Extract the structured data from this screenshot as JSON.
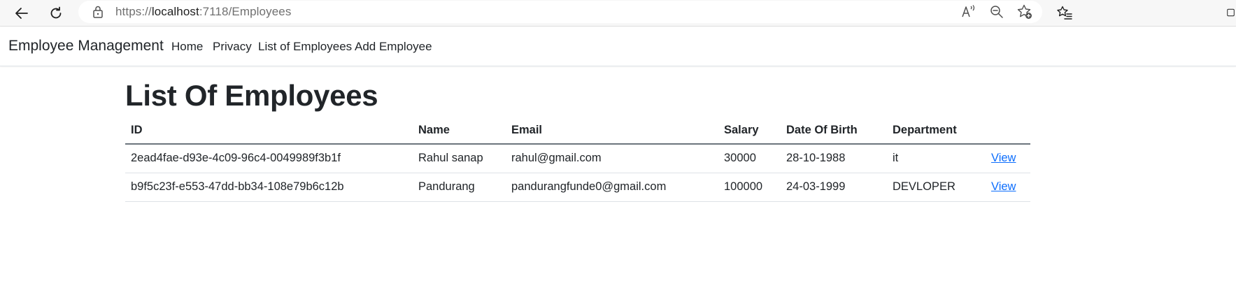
{
  "browser": {
    "url_scheme": "https://",
    "url_host": "localhost",
    "url_path": ":7118/Employees"
  },
  "icons": {
    "back": "back-arrow-icon",
    "reload": "reload-icon",
    "lock": "lock-icon",
    "read_aloud": "read-aloud-icon",
    "zoom_out": "zoom-out-icon",
    "add_favorite": "add-favorite-icon",
    "favorites": "favorites-icon"
  },
  "navbar": {
    "brand": "Employee Management",
    "links": [
      "Home",
      "Privacy",
      "List of Employees",
      "Add Employee"
    ]
  },
  "page": {
    "title": "List Of Employees"
  },
  "table": {
    "headers": [
      "ID",
      "Name",
      "Email",
      "Salary",
      "Date Of Birth",
      "Department"
    ],
    "rows": [
      [
        "2ead4fae-d93e-4c09-96c4-0049989f3b1f",
        "Rahul sanap",
        "rahul@gmail.com",
        "30000",
        "28-10-1988",
        "it",
        "View"
      ],
      [
        "b9f5c23f-e553-47dd-bb34-108e79b6c12b",
        "Pandurang",
        "pandurangfunde0@gmail.com",
        "100000",
        "24-03-1999",
        "DEVLOPER",
        "View"
      ]
    ]
  },
  "colors": {
    "link": "#0d6efd",
    "text": "#212529",
    "header_border": "#6c757d",
    "row_border": "#dee2e6"
  }
}
